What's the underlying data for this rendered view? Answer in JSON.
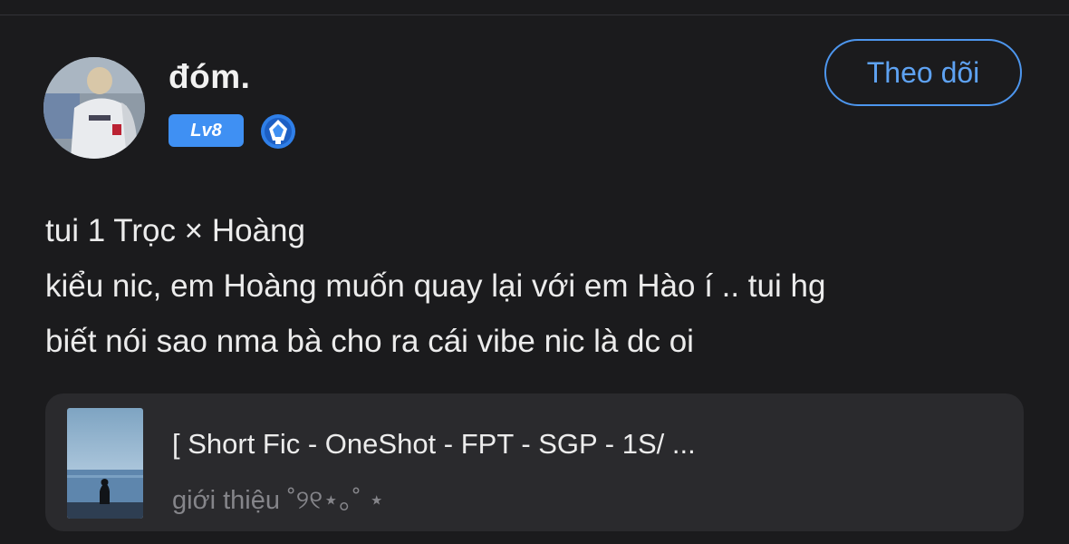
{
  "user": {
    "name": "đóm.",
    "level": "Lv8"
  },
  "follow_button": {
    "label": "Theo dõi"
  },
  "post": {
    "lines": [
      "tui 1 Trọc × Hoàng",
      "kiểu nic, em Hoàng muốn quay lại với em Hào í .. tui hg",
      "biết nói sao nma bà cho ra cái vibe nic là dc oi"
    ]
  },
  "story_card": {
    "title": "[ Short Fic - OneShot - FPT - SGP - 1S/ ...",
    "description": "giới thiệu ˚୨୧⋆｡˚ ⋆"
  },
  "colors": {
    "background": "#1b1b1d",
    "accent": "#4d96ee",
    "badge": "#3f90f3",
    "card": "#2a2a2d"
  },
  "icons": {
    "rank": "shield-rank-icon"
  }
}
